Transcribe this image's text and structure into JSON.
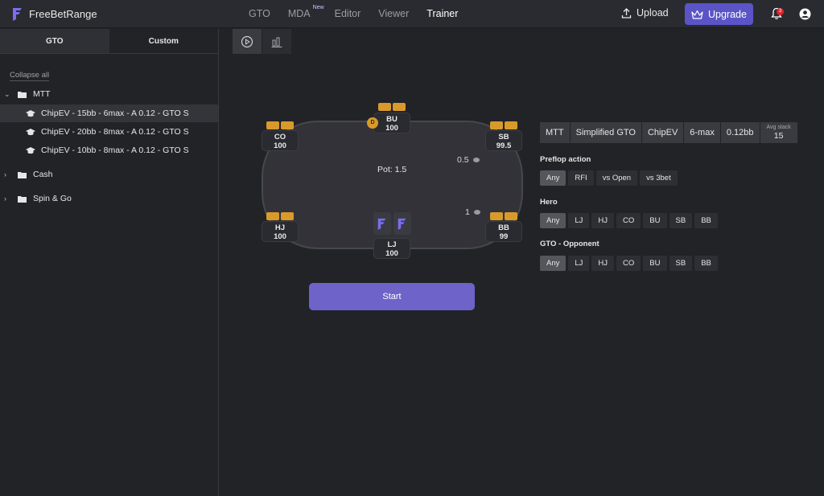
{
  "brand": {
    "name": "FreeBetRange",
    "accent": "#6d63c9"
  },
  "nav": {
    "items": [
      {
        "label": "GTO"
      },
      {
        "label": "MDA",
        "badge": "New"
      },
      {
        "label": "Editor"
      },
      {
        "label": "Viewer"
      },
      {
        "label": "Trainer"
      }
    ],
    "upload_label": "Upload",
    "upgrade_label": "Upgrade",
    "notification_count": "3"
  },
  "sidebar": {
    "tabs": [
      {
        "label": "GTO"
      },
      {
        "label": "Custom"
      }
    ],
    "collapse_label": "Collapse all",
    "tree": [
      {
        "label": "MTT"
      },
      {
        "label": "ChipEV - 15bb - 6max - A 0.12 - GTO S"
      },
      {
        "label": "ChipEV - 20bb - 8max - A 0.12 - GTO S"
      },
      {
        "label": "ChipEV - 10bb - 8max - A 0.12 - GTO S"
      },
      {
        "label": "Cash"
      },
      {
        "label": "Spin & Go"
      }
    ]
  },
  "table": {
    "pot": "Pot: 1.5",
    "dealer": "D",
    "seats": [
      {
        "pos": "BU",
        "stack": "100"
      },
      {
        "pos": "CO",
        "stack": "100"
      },
      {
        "pos": "SB",
        "stack": "99.5"
      },
      {
        "pos": "HJ",
        "stack": "100"
      },
      {
        "pos": "BB",
        "stack": "99"
      },
      {
        "pos": "LJ",
        "stack": "100"
      }
    ],
    "bets": [
      {
        "amount": "0.5"
      },
      {
        "amount": "1"
      }
    ]
  },
  "start_label": "Start",
  "preset": {
    "items": [
      "MTT",
      "Simplified GTO",
      "ChipEV",
      "6-max",
      "0.12bb"
    ],
    "avg_stack_label": "Avg stack",
    "avg_stack_value": "15"
  },
  "filters": {
    "preflop": {
      "label": "Preflop action",
      "options": [
        "Any",
        "RFI",
        "vs Open",
        "vs 3bet"
      ]
    },
    "hero": {
      "label": "Hero",
      "options": [
        "Any",
        "LJ",
        "HJ",
        "CO",
        "BU",
        "SB",
        "BB"
      ]
    },
    "opponent": {
      "label": "GTO - Opponent",
      "options": [
        "Any",
        "LJ",
        "HJ",
        "CO",
        "BU",
        "SB",
        "BB"
      ]
    }
  }
}
